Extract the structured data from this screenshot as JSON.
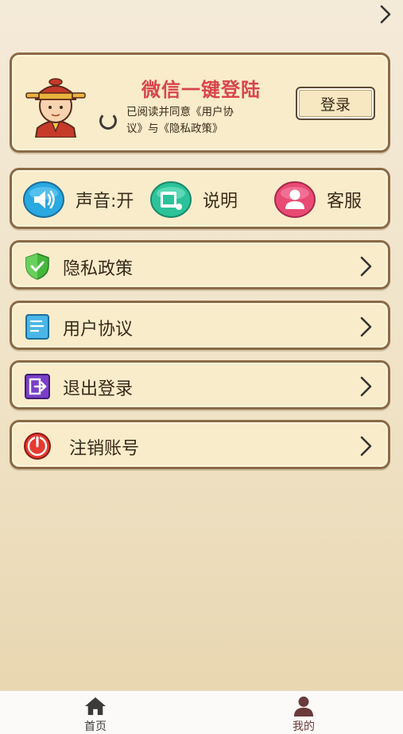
{
  "header": {
    "forward_icon": "chevron-right-icon"
  },
  "login_card": {
    "title": "微信一键登陆",
    "agreement_line1": "已阅读并同意《用户协",
    "agreement_line2": "议》与《隐私政策》",
    "login_button": "登录",
    "avatar_icon": "official-avatar-icon",
    "title_color": "#d8454b"
  },
  "actions": [
    {
      "label": "声音:开",
      "icon": "speaker-icon"
    },
    {
      "label": "说明",
      "icon": "instructions-icon"
    },
    {
      "label": "客服",
      "icon": "customer-service-icon"
    }
  ],
  "menu": [
    {
      "label": "隐私政策",
      "icon": "shield-check-icon"
    },
    {
      "label": "用户协议",
      "icon": "document-icon"
    },
    {
      "label": "退出登录",
      "icon": "logout-icon"
    },
    {
      "label": "注销账号",
      "icon": "power-icon"
    }
  ],
  "bottom_nav": [
    {
      "label": "首页",
      "icon": "home-icon",
      "active": false
    },
    {
      "label": "我的",
      "icon": "user-icon",
      "active": true
    }
  ],
  "colors": {
    "card_border": "#8a6a45",
    "card_bg": "#f9ecca",
    "nav_inactive": "#3a3a3a",
    "nav_active": "#6b3a3a"
  }
}
